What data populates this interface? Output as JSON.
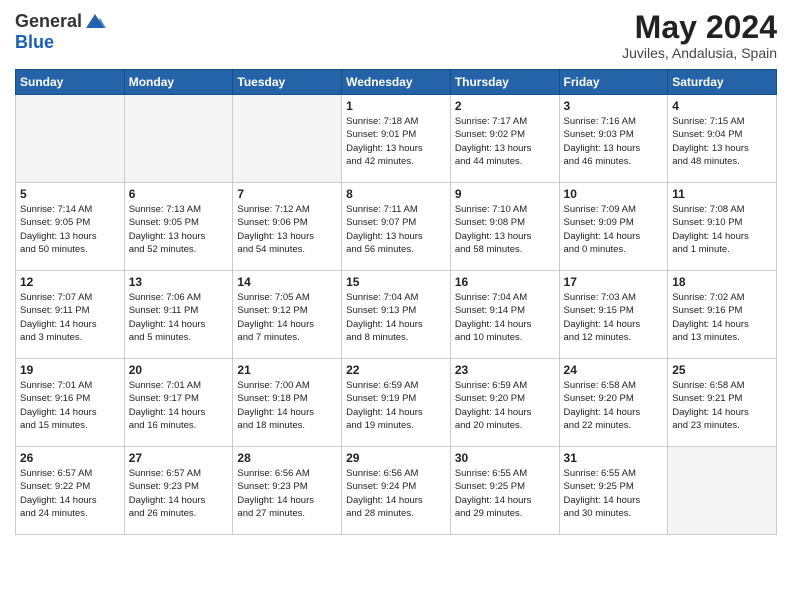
{
  "header": {
    "logo_general": "General",
    "logo_blue": "Blue",
    "month_title": "May 2024",
    "location": "Juviles, Andalusia, Spain"
  },
  "days_of_week": [
    "Sunday",
    "Monday",
    "Tuesday",
    "Wednesday",
    "Thursday",
    "Friday",
    "Saturday"
  ],
  "weeks": [
    [
      {
        "day": "",
        "info": ""
      },
      {
        "day": "",
        "info": ""
      },
      {
        "day": "",
        "info": ""
      },
      {
        "day": "1",
        "info": "Sunrise: 7:18 AM\nSunset: 9:01 PM\nDaylight: 13 hours\nand 42 minutes."
      },
      {
        "day": "2",
        "info": "Sunrise: 7:17 AM\nSunset: 9:02 PM\nDaylight: 13 hours\nand 44 minutes."
      },
      {
        "day": "3",
        "info": "Sunrise: 7:16 AM\nSunset: 9:03 PM\nDaylight: 13 hours\nand 46 minutes."
      },
      {
        "day": "4",
        "info": "Sunrise: 7:15 AM\nSunset: 9:04 PM\nDaylight: 13 hours\nand 48 minutes."
      }
    ],
    [
      {
        "day": "5",
        "info": "Sunrise: 7:14 AM\nSunset: 9:05 PM\nDaylight: 13 hours\nand 50 minutes."
      },
      {
        "day": "6",
        "info": "Sunrise: 7:13 AM\nSunset: 9:05 PM\nDaylight: 13 hours\nand 52 minutes."
      },
      {
        "day": "7",
        "info": "Sunrise: 7:12 AM\nSunset: 9:06 PM\nDaylight: 13 hours\nand 54 minutes."
      },
      {
        "day": "8",
        "info": "Sunrise: 7:11 AM\nSunset: 9:07 PM\nDaylight: 13 hours\nand 56 minutes."
      },
      {
        "day": "9",
        "info": "Sunrise: 7:10 AM\nSunset: 9:08 PM\nDaylight: 13 hours\nand 58 minutes."
      },
      {
        "day": "10",
        "info": "Sunrise: 7:09 AM\nSunset: 9:09 PM\nDaylight: 14 hours\nand 0 minutes."
      },
      {
        "day": "11",
        "info": "Sunrise: 7:08 AM\nSunset: 9:10 PM\nDaylight: 14 hours\nand 1 minute."
      }
    ],
    [
      {
        "day": "12",
        "info": "Sunrise: 7:07 AM\nSunset: 9:11 PM\nDaylight: 14 hours\nand 3 minutes."
      },
      {
        "day": "13",
        "info": "Sunrise: 7:06 AM\nSunset: 9:11 PM\nDaylight: 14 hours\nand 5 minutes."
      },
      {
        "day": "14",
        "info": "Sunrise: 7:05 AM\nSunset: 9:12 PM\nDaylight: 14 hours\nand 7 minutes."
      },
      {
        "day": "15",
        "info": "Sunrise: 7:04 AM\nSunset: 9:13 PM\nDaylight: 14 hours\nand 8 minutes."
      },
      {
        "day": "16",
        "info": "Sunrise: 7:04 AM\nSunset: 9:14 PM\nDaylight: 14 hours\nand 10 minutes."
      },
      {
        "day": "17",
        "info": "Sunrise: 7:03 AM\nSunset: 9:15 PM\nDaylight: 14 hours\nand 12 minutes."
      },
      {
        "day": "18",
        "info": "Sunrise: 7:02 AM\nSunset: 9:16 PM\nDaylight: 14 hours\nand 13 minutes."
      }
    ],
    [
      {
        "day": "19",
        "info": "Sunrise: 7:01 AM\nSunset: 9:16 PM\nDaylight: 14 hours\nand 15 minutes."
      },
      {
        "day": "20",
        "info": "Sunrise: 7:01 AM\nSunset: 9:17 PM\nDaylight: 14 hours\nand 16 minutes."
      },
      {
        "day": "21",
        "info": "Sunrise: 7:00 AM\nSunset: 9:18 PM\nDaylight: 14 hours\nand 18 minutes."
      },
      {
        "day": "22",
        "info": "Sunrise: 6:59 AM\nSunset: 9:19 PM\nDaylight: 14 hours\nand 19 minutes."
      },
      {
        "day": "23",
        "info": "Sunrise: 6:59 AM\nSunset: 9:20 PM\nDaylight: 14 hours\nand 20 minutes."
      },
      {
        "day": "24",
        "info": "Sunrise: 6:58 AM\nSunset: 9:20 PM\nDaylight: 14 hours\nand 22 minutes."
      },
      {
        "day": "25",
        "info": "Sunrise: 6:58 AM\nSunset: 9:21 PM\nDaylight: 14 hours\nand 23 minutes."
      }
    ],
    [
      {
        "day": "26",
        "info": "Sunrise: 6:57 AM\nSunset: 9:22 PM\nDaylight: 14 hours\nand 24 minutes."
      },
      {
        "day": "27",
        "info": "Sunrise: 6:57 AM\nSunset: 9:23 PM\nDaylight: 14 hours\nand 26 minutes."
      },
      {
        "day": "28",
        "info": "Sunrise: 6:56 AM\nSunset: 9:23 PM\nDaylight: 14 hours\nand 27 minutes."
      },
      {
        "day": "29",
        "info": "Sunrise: 6:56 AM\nSunset: 9:24 PM\nDaylight: 14 hours\nand 28 minutes."
      },
      {
        "day": "30",
        "info": "Sunrise: 6:55 AM\nSunset: 9:25 PM\nDaylight: 14 hours\nand 29 minutes."
      },
      {
        "day": "31",
        "info": "Sunrise: 6:55 AM\nSunset: 9:25 PM\nDaylight: 14 hours\nand 30 minutes."
      },
      {
        "day": "",
        "info": ""
      }
    ]
  ]
}
